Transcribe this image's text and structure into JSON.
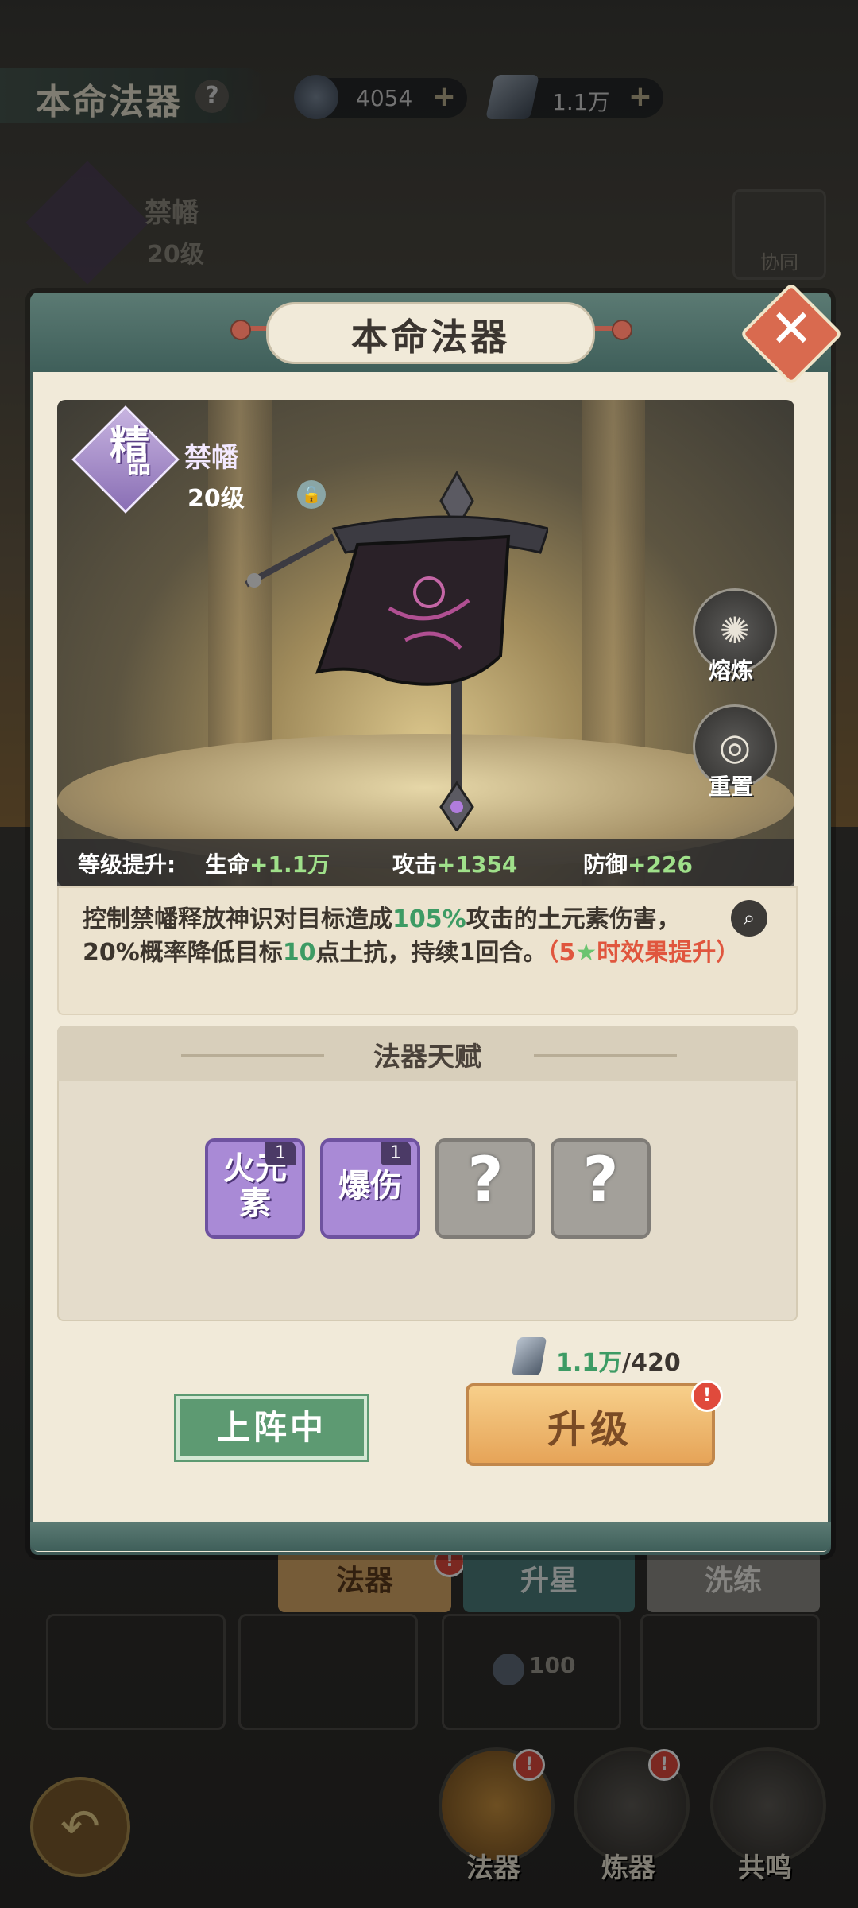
{
  "header": {
    "title": "本命法器",
    "help_icon": "?",
    "resources": [
      {
        "icon": "spirit-coin-icon",
        "value": "4054"
      },
      {
        "icon": "feather-crystal-icon",
        "value": "1.1万"
      }
    ]
  },
  "background_item": {
    "quality": "精品",
    "name": "禁幡",
    "level": "20级",
    "assist_label": "协同"
  },
  "modal": {
    "title": "本命法器",
    "close_icon": "✕",
    "item": {
      "quality_main": "精",
      "quality_sub": "品",
      "name": "禁幡",
      "level": "20级"
    },
    "side_buttons": [
      {
        "label": "熔炼",
        "icon": "smelt-icon"
      },
      {
        "label": "重置",
        "icon": "reset-icon"
      }
    ],
    "stats": {
      "prefix": "等级提升:",
      "hp_label": "生命",
      "hp_value": "+1.1万",
      "atk_label": "攻击",
      "atk_value": "+1354",
      "def_label": "防御",
      "def_value": "+226"
    },
    "description": {
      "part1": "控制禁幡释放神识对目标造成",
      "pct": "105%",
      "part2": "攻击的土元素伤害，",
      "part3": "20%概率降低目标",
      "num": "10",
      "part4": "点土抗，持续1回合。",
      "note_open": "（5",
      "star": "★",
      "note_close": "时效果提升）"
    },
    "talents": {
      "title": "法器天赋",
      "slots": [
        {
          "label": "火元素",
          "level": "1",
          "active": true
        },
        {
          "label": "爆伤",
          "level": "1",
          "active": true
        },
        {
          "label": "?",
          "active": false
        },
        {
          "label": "?",
          "active": false
        }
      ]
    },
    "cost": {
      "have": "1.1万",
      "need": "/420"
    },
    "deploy_label": "上阵中",
    "upgrade_label": "升级"
  },
  "lower_tabs": [
    "法器",
    "升星",
    "洗练"
  ],
  "lower_cost": "100",
  "bottom_nav": [
    {
      "label": "法器",
      "alert": true
    },
    {
      "label": "炼器",
      "alert": true
    },
    {
      "label": "共鸣",
      "alert": false
    }
  ],
  "colors": {
    "accent_green": "#3d9b64",
    "stat_green": "#9fe08a",
    "alert_red": "#e04a3c",
    "purple_quality": "#a98ad6",
    "modal_teal": "#3f5f5a"
  }
}
